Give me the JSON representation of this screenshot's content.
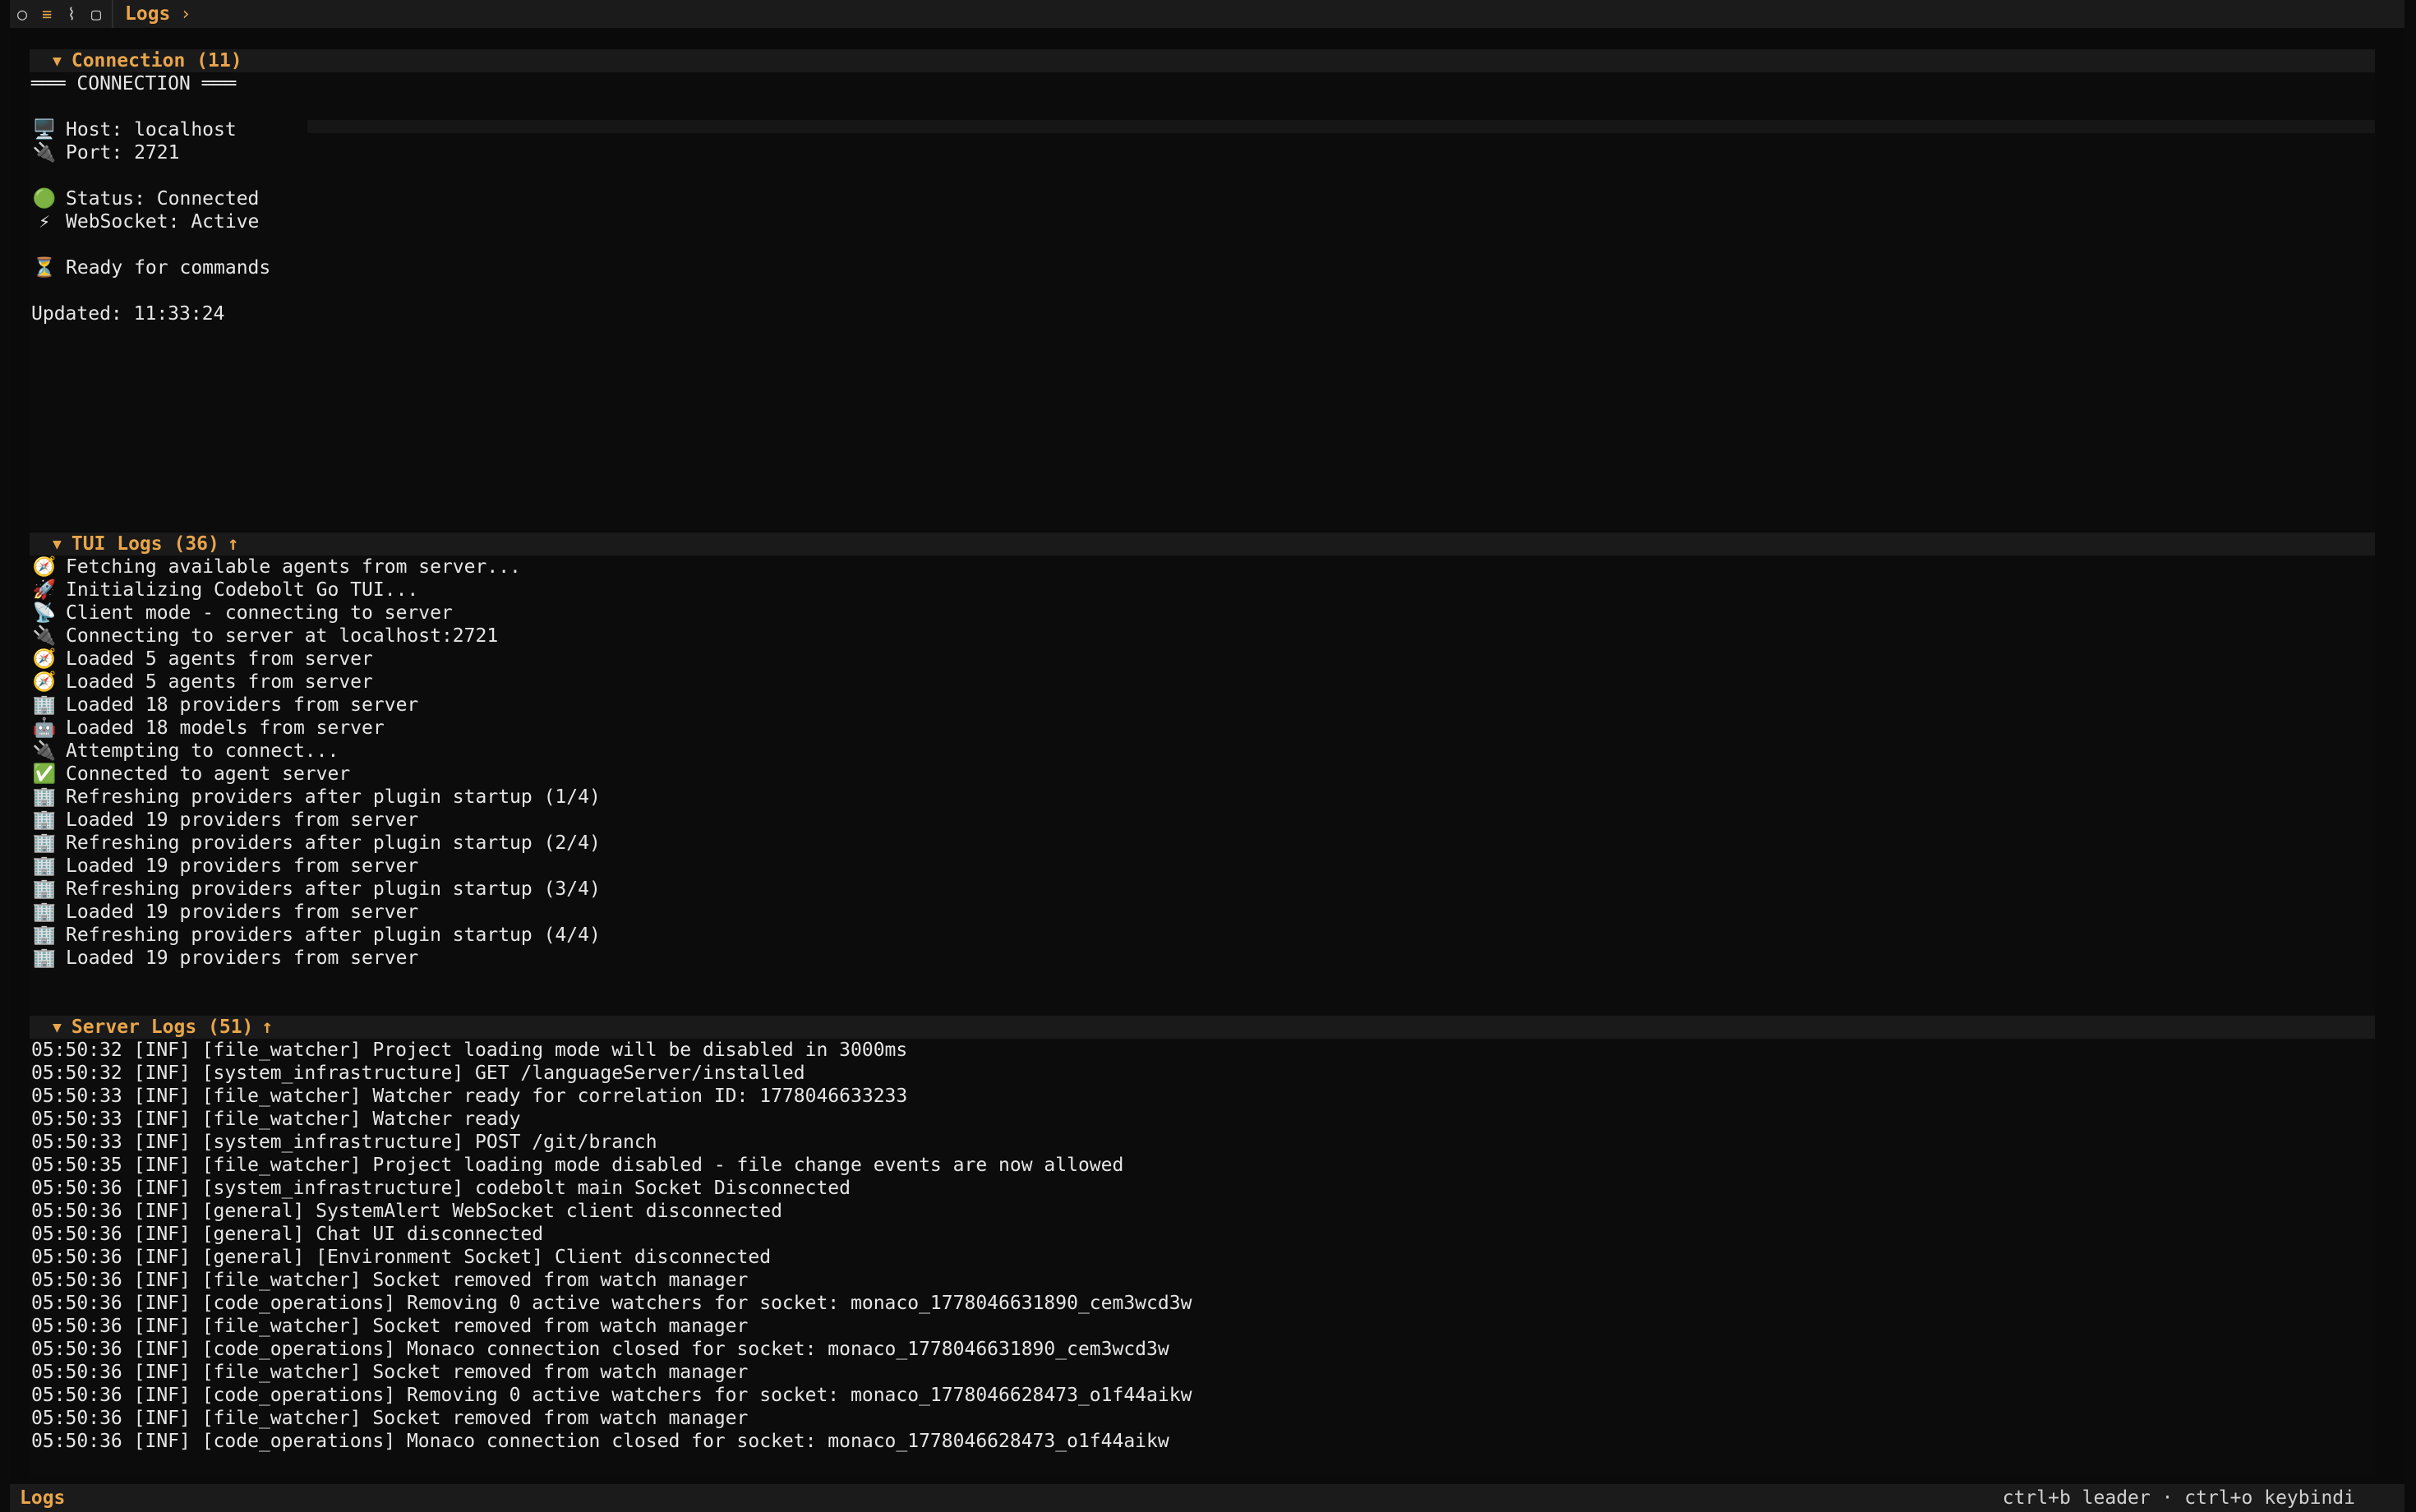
{
  "topbar": {
    "icons": [
      "circle-icon",
      "menu-icon",
      "chart-icon",
      "square-icon"
    ],
    "tab_label": "Logs",
    "chevron": "›"
  },
  "connection": {
    "header": "Connection (11)",
    "title_line": "═══ CONNECTION ═══",
    "host": "Host: localhost",
    "port": "Port: 2721",
    "status": "Status: Connected",
    "websocket": "WebSocket: Active",
    "ready": "Ready for commands",
    "updated": "Updated: 11:33:24"
  },
  "tui_logs": {
    "header": "TUI Logs (36)",
    "lines": [
      {
        "icon": "🧭",
        "text": "Fetching available agents from server..."
      },
      {
        "icon": "🚀",
        "text": "Initializing Codebolt Go TUI..."
      },
      {
        "icon": "📡",
        "text": "Client mode - connecting to server"
      },
      {
        "icon": "🔌",
        "text": "Connecting to server at localhost:2721"
      },
      {
        "icon": "🧭",
        "text": "Loaded 5 agents from server"
      },
      {
        "icon": "🧭",
        "text": "Loaded 5 agents from server"
      },
      {
        "icon": "🏢",
        "text": "Loaded 18 providers from server"
      },
      {
        "icon": "🤖",
        "text": "Loaded 18 models from server"
      },
      {
        "icon": "🔌",
        "text": "Attempting to connect..."
      },
      {
        "icon": "✅",
        "text": "Connected to agent server"
      },
      {
        "icon": "🏢",
        "text": "Refreshing providers after plugin startup (1/4)"
      },
      {
        "icon": "🏢",
        "text": "Loaded 19 providers from server"
      },
      {
        "icon": "🏢",
        "text": "Refreshing providers after plugin startup (2/4)"
      },
      {
        "icon": "🏢",
        "text": "Loaded 19 providers from server"
      },
      {
        "icon": "🏢",
        "text": "Refreshing providers after plugin startup (3/4)"
      },
      {
        "icon": "🏢",
        "text": "Loaded 19 providers from server"
      },
      {
        "icon": "🏢",
        "text": "Refreshing providers after plugin startup (4/4)"
      },
      {
        "icon": "🏢",
        "text": "Loaded 19 providers from server"
      }
    ]
  },
  "server_logs": {
    "header": "Server Logs (51)",
    "lines": [
      "05:50:32 [INF] [file_watcher] Project loading mode will be disabled in 3000ms",
      "05:50:32 [INF] [system_infrastructure] GET /languageServer/installed",
      "05:50:33 [INF] [file_watcher] Watcher ready for correlation ID: 1778046633233",
      "05:50:33 [INF] [file_watcher] Watcher ready",
      "05:50:33 [INF] [system_infrastructure] POST /git/branch",
      "05:50:35 [INF] [file_watcher] Project loading mode disabled - file change events are now allowed",
      "05:50:36 [INF] [system_infrastructure] codebolt main Socket Disconnected",
      "05:50:36 [INF] [general] SystemAlert WebSocket client disconnected",
      "05:50:36 [INF] [general] Chat UI disconnected",
      "05:50:36 [INF] [general] [Environment Socket] Client disconnected",
      "05:50:36 [INF] [file_watcher] Socket removed from watch manager",
      "05:50:36 [INF] [code_operations] Removing 0 active watchers for socket: monaco_1778046631890_cem3wcd3w",
      "05:50:36 [INF] [file_watcher] Socket removed from watch manager",
      "05:50:36 [INF] [code_operations] Monaco connection closed for socket: monaco_1778046631890_cem3wcd3w",
      "05:50:36 [INF] [file_watcher] Socket removed from watch manager",
      "05:50:36 [INF] [code_operations] Removing 0 active watchers for socket: monaco_1778046628473_o1f44aikw",
      "05:50:36 [INF] [file_watcher] Socket removed from watch manager",
      "05:50:36 [INF] [code_operations] Monaco connection closed for socket: monaco_1778046628473_o1f44aikw"
    ]
  },
  "footer": {
    "title": "Logs",
    "hint": "ctrl+b leader · ctrl+o keybindi"
  },
  "colors": {
    "accent": "#e8a54b",
    "background": "#0b0b0b",
    "text": "#e6e6e6"
  }
}
